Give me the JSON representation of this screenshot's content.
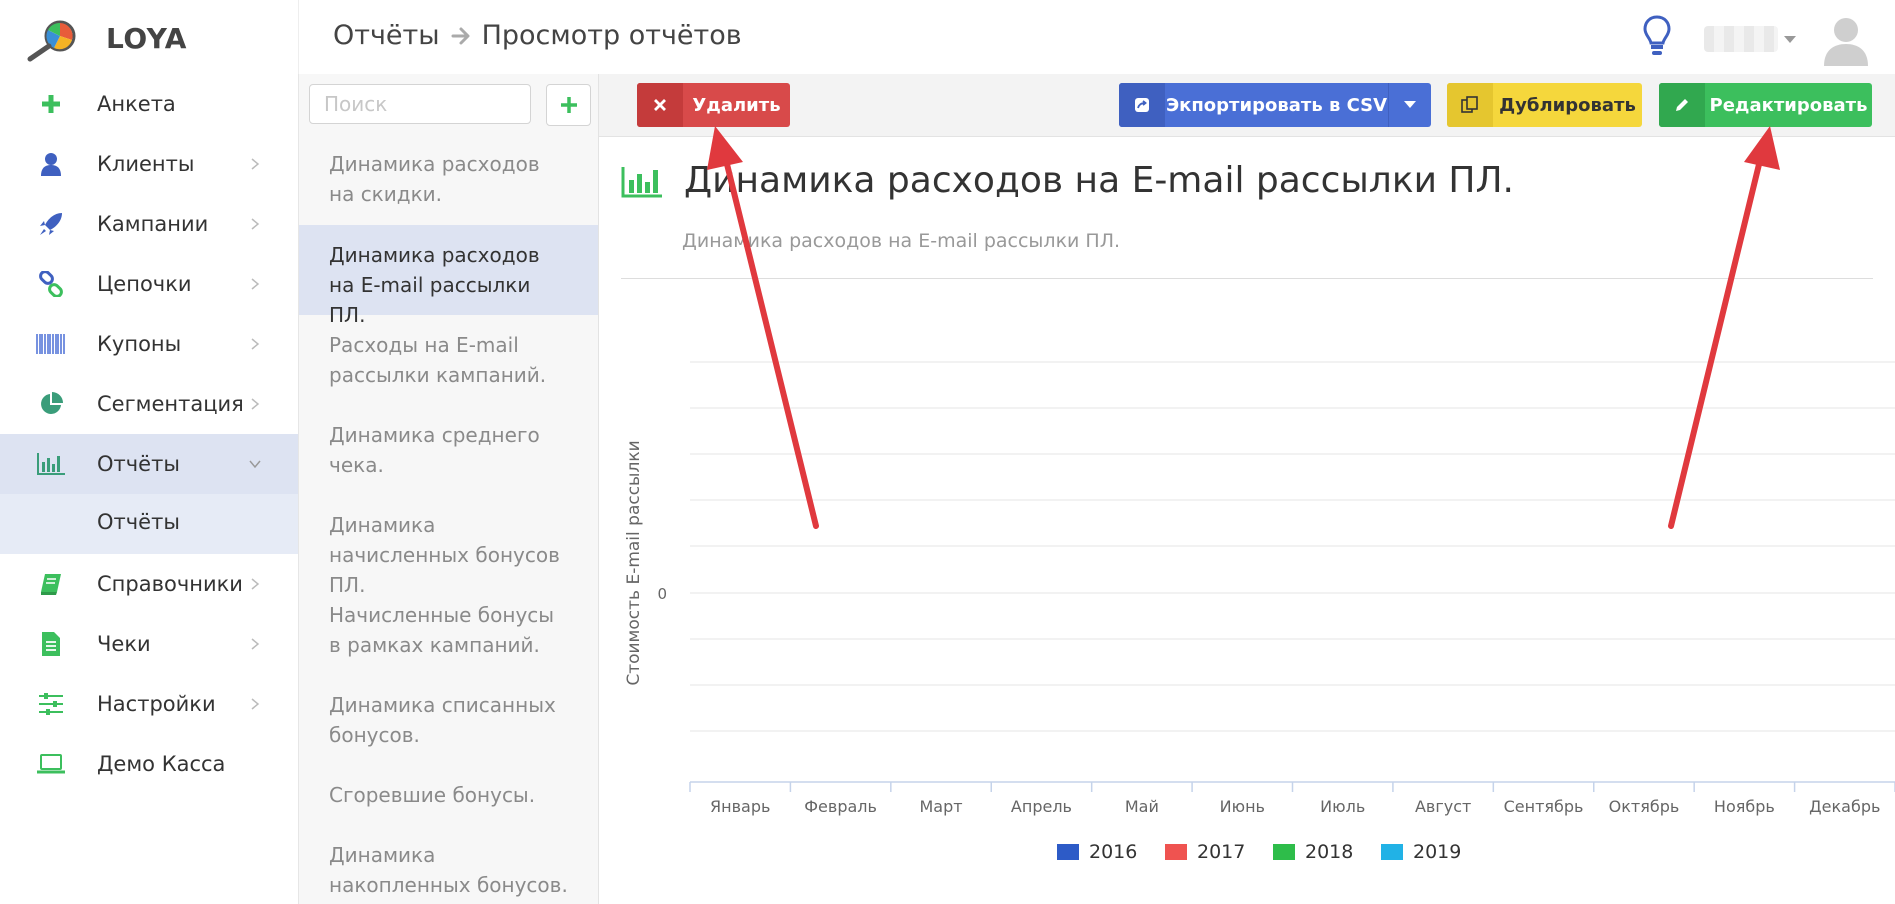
{
  "header": {
    "brand": "LOYA",
    "breadcrumb": [
      "Отчёты",
      "Просмотр отчётов"
    ]
  },
  "sidebar": {
    "items": [
      {
        "label": "Анкета",
        "icon": "plus-icon",
        "has_children": false
      },
      {
        "label": "Клиенты",
        "icon": "user-icon",
        "has_children": true
      },
      {
        "label": "Кампании",
        "icon": "rocket-icon",
        "has_children": true
      },
      {
        "label": "Цепочки",
        "icon": "link-icon",
        "has_children": true
      },
      {
        "label": "Купоны",
        "icon": "barcode-icon",
        "has_children": true
      },
      {
        "label": "Сегментация",
        "icon": "pie-chart-icon",
        "has_children": true
      },
      {
        "label": "Отчёты",
        "icon": "bar-chart-icon",
        "has_children": true,
        "active": true,
        "expanded": true
      },
      {
        "label": "Справочники",
        "icon": "book-icon",
        "has_children": true
      },
      {
        "label": "Чеки",
        "icon": "receipt-icon",
        "has_children": true
      },
      {
        "label": "Настройки",
        "icon": "sliders-icon",
        "has_children": true
      },
      {
        "label": "Демо Касса",
        "icon": "laptop-icon",
        "has_children": false
      }
    ],
    "subitem": "Отчёты"
  },
  "report_list": {
    "search_placeholder": "Поиск",
    "items": [
      "Динамика расходов на скидки.",
      "Динамика расходов на E-mail рассылки ПЛ.",
      "Расходы на E-mail рассылки кампаний.",
      "Динамика среднего чека.",
      "Динамика начисленных бонусов ПЛ.",
      "Начисленные бонусы в рамках кампаний.",
      "Динамика списанных бонусов.",
      "Сгоревшие бонусы.",
      "Динамика накопленных бонусов."
    ],
    "selected_index": 1
  },
  "toolbar": {
    "delete_label": "Удалить",
    "export_label": "Экпортировать в CSV",
    "duplicate_label": "Дублировать",
    "edit_label": "Редактировать"
  },
  "report": {
    "title": "Динамика расходов на E-mail рассылки ПЛ.",
    "subtitle": "Динамика расходов на E-mail рассылки ПЛ."
  },
  "colors": {
    "accent_green": "#3cbf5d",
    "danger": "#d84a4a",
    "primary": "#4a6fd6",
    "warning": "#f5d73c",
    "annotation_arrow": "#e0393e"
  },
  "chart_data": {
    "type": "bar",
    "categories": [
      "Январь",
      "Февраль",
      "Март",
      "Апрель",
      "Май",
      "Июнь",
      "Июль",
      "Август",
      "Сентябрь",
      "Октябрь",
      "Ноябрь",
      "Декабрь"
    ],
    "series": [
      {
        "name": "2016",
        "color": "#2d5bc7",
        "values": [
          0,
          0,
          0,
          0,
          0,
          0,
          0,
          0,
          0,
          0,
          0,
          0
        ]
      },
      {
        "name": "2017",
        "color": "#ef5350",
        "values": [
          0,
          0,
          0,
          0,
          0,
          0,
          0,
          0,
          0,
          0,
          0,
          0
        ]
      },
      {
        "name": "2018",
        "color": "#2ebd4a",
        "values": [
          0,
          0,
          0,
          0,
          0,
          0,
          0,
          0,
          0,
          0,
          0,
          0
        ]
      },
      {
        "name": "2019",
        "color": "#21b2e6",
        "values": [
          0,
          0,
          0,
          0,
          0,
          0,
          0,
          0,
          0,
          0,
          0,
          0
        ]
      }
    ],
    "ylabel": "Стоимость E-mail рассылки",
    "y_ticks": [
      "0"
    ],
    "grid": true,
    "legend": "bottom"
  }
}
